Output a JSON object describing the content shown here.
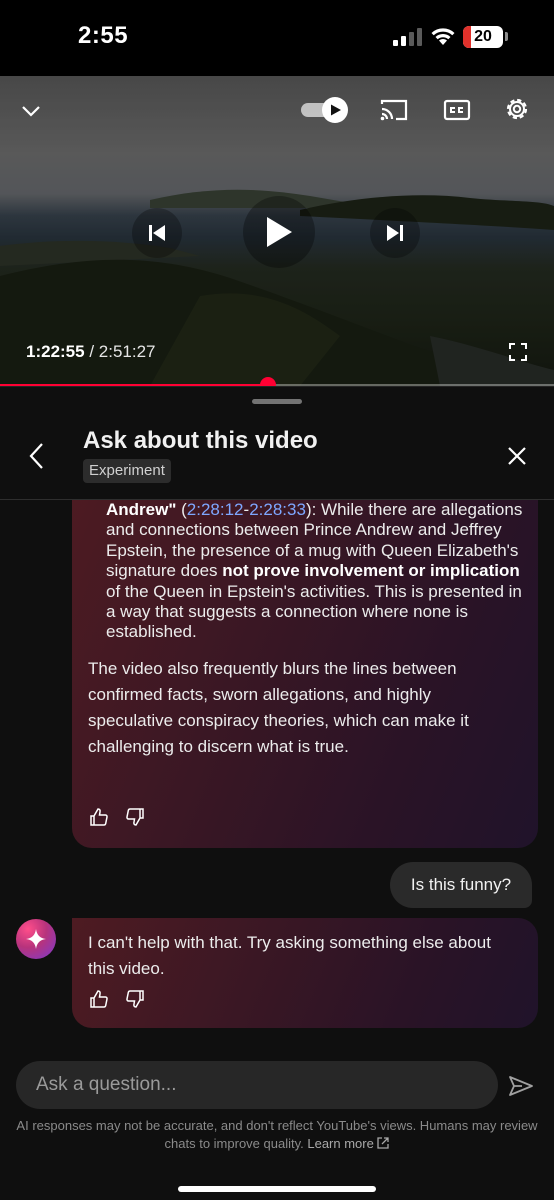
{
  "status_bar": {
    "time": "2:55",
    "battery_level": "20",
    "signal_icon": "cellular-signal-icon",
    "wifi_icon": "wifi-icon"
  },
  "player": {
    "current_time": "1:22:55",
    "separator": " / ",
    "duration": "2:51:27",
    "progress_fraction": 0.484,
    "accent_color": "#ff0033",
    "icons": [
      "chevron-down-icon",
      "autoplay-toggle-icon",
      "cast-icon",
      "closed-captions-icon",
      "gear-icon",
      "previous-icon",
      "play-icon",
      "next-icon",
      "fullscreen-icon"
    ]
  },
  "panel": {
    "title": "Ask about this video",
    "badge": "Experiment"
  },
  "chat": {
    "first_answer": {
      "bullet_title": "Andrew\"",
      "ts_open": " (",
      "ts_start": "2:28:12",
      "ts_dash": "-",
      "ts_end": "2:28:33",
      "text_part1": "): While there are allegations and connections between Prince Andrew and Jeffrey Epstein, the presence of a mug with Queen Elizabeth's signature does ",
      "text_bold": "not prove involvement or implication",
      "text_part2": " of the Queen in Epstein's activities. This is presented in a way that suggests a connection where none is established.",
      "paragraph": "The video also frequently blurs the lines between confirmed facts, sworn allegations, and highly speculative conspiracy theories, which can make it challenging to discern what is true."
    },
    "user_message": "Is this funny?",
    "second_answer": "I can't help with that. Try asking something else about this video."
  },
  "input": {
    "placeholder": "Ask a question..."
  },
  "footer": {
    "disclaimer": "AI responses may not be accurate, and don't reflect YouTube's views. Humans may review chats to improve quality. ",
    "learn_more": "Learn more"
  }
}
